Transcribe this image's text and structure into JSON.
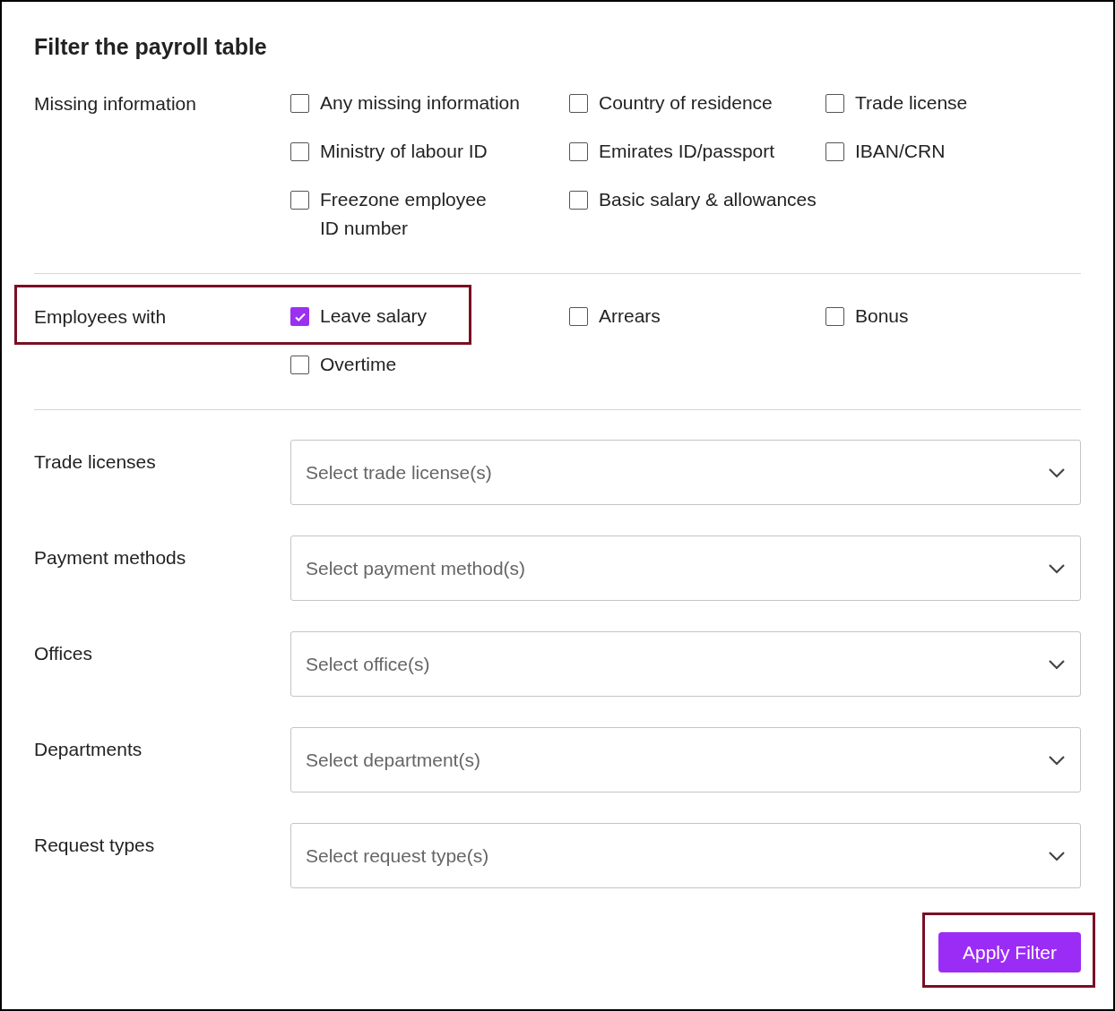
{
  "title": "Filter the payroll table",
  "sections": [
    {
      "label": "Missing information",
      "highlighted": false,
      "options": [
        {
          "label": "Any missing information",
          "checked": false
        },
        {
          "label": "Country of residence",
          "checked": false
        },
        {
          "label": "Trade license",
          "checked": false
        },
        {
          "label": "Ministry of labour ID",
          "checked": false
        },
        {
          "label": "Emirates ID/passport",
          "checked": false
        },
        {
          "label": "IBAN/CRN",
          "checked": false
        },
        {
          "label": "Freezone employee ID number",
          "checked": false
        },
        {
          "label": "Basic salary & allowances",
          "checked": false
        }
      ]
    },
    {
      "label": "Employees with",
      "highlighted": true,
      "options": [
        {
          "label": "Leave salary",
          "checked": true
        },
        {
          "label": "Arrears",
          "checked": false
        },
        {
          "label": "Bonus",
          "checked": false
        },
        {
          "label": "Overtime",
          "checked": false
        }
      ]
    }
  ],
  "dropdowns": [
    {
      "label": "Trade licenses",
      "placeholder": "Select trade license(s)"
    },
    {
      "label": "Payment methods",
      "placeholder": "Select payment method(s)"
    },
    {
      "label": "Offices",
      "placeholder": "Select office(s)"
    },
    {
      "label": "Departments",
      "placeholder": "Select department(s)"
    },
    {
      "label": "Request types",
      "placeholder": "Select request type(s)"
    }
  ],
  "apply_button": {
    "label": "Apply Filter",
    "highlighted": true
  }
}
